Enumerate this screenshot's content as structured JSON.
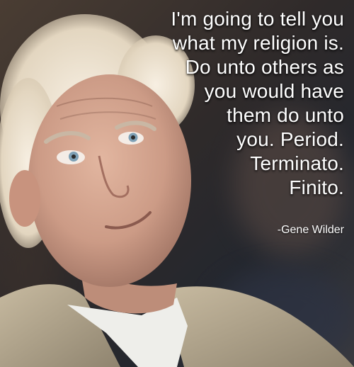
{
  "quote": {
    "lines": [
      "I'm going to tell you",
      "what my religion is.",
      "Do unto others as",
      "you would have",
      "them do unto",
      "you. Period.",
      "Terminato.",
      "Finito."
    ]
  },
  "attribution": "-Gene Wilder",
  "colors": {
    "text": "#ffffff",
    "hair": "#e8dccb",
    "skin": "#d6a48d",
    "jacket": "#b8aa8f"
  }
}
